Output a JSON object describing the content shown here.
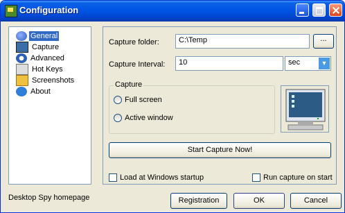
{
  "window": {
    "title": "Configuration",
    "icon": "desktop-spy-icon"
  },
  "nav": {
    "items": [
      {
        "label": "General",
        "icon": "globe-icon",
        "selected": true
      },
      {
        "label": "Capture",
        "icon": "monitor-icon"
      },
      {
        "label": "Advanced",
        "icon": "gear-icon"
      },
      {
        "label": "Hot Keys",
        "icon": "keyboard-icon"
      },
      {
        "label": "Screenshots",
        "icon": "folder-icon"
      },
      {
        "label": "About",
        "icon": "info-icon"
      }
    ]
  },
  "general": {
    "capture_folder_label": "Capture folder:",
    "capture_folder_value": "C:\\Temp",
    "browse_label": "...",
    "capture_interval_label": "Capture Interval:",
    "capture_interval_value": "10",
    "interval_unit": "sec",
    "capture_group_label": "Capture",
    "full_screen_label": "Full screen",
    "active_window_label": "Active window",
    "start_capture_label": "Start Capture Now!",
    "load_startup_label": "Load at Windows startup",
    "run_capture_label": "Run capture on start"
  },
  "footer": {
    "homepage_label": "Desktop Spy homepage",
    "registration_label": "Registration",
    "ok_label": "OK",
    "cancel_label": "Cancel"
  },
  "colors": {
    "titlebar": "#0054e3",
    "selected": "#316ac5",
    "window_bg": "#ece9d8"
  }
}
